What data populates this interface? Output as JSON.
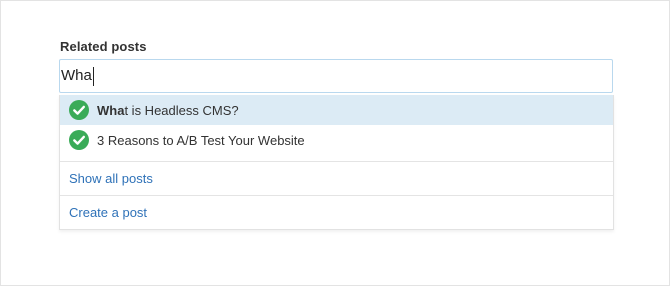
{
  "field": {
    "label": "Related posts"
  },
  "search": {
    "value": "Wha"
  },
  "suggestions": [
    {
      "match": "Wha",
      "rest": "t is Headless CMS?",
      "icon": "check-circle-icon",
      "active": true
    },
    {
      "match": "",
      "rest": "3 Reasons to A/B Test Your Website",
      "icon": "check-circle-icon",
      "active": false
    }
  ],
  "actions": {
    "show_all": "Show all posts",
    "create": "Create a post"
  },
  "colors": {
    "check_green": "#3aab58",
    "link_blue": "#2f72b8",
    "active_row": "#dcebf5",
    "input_border": "#b9d8ee"
  }
}
